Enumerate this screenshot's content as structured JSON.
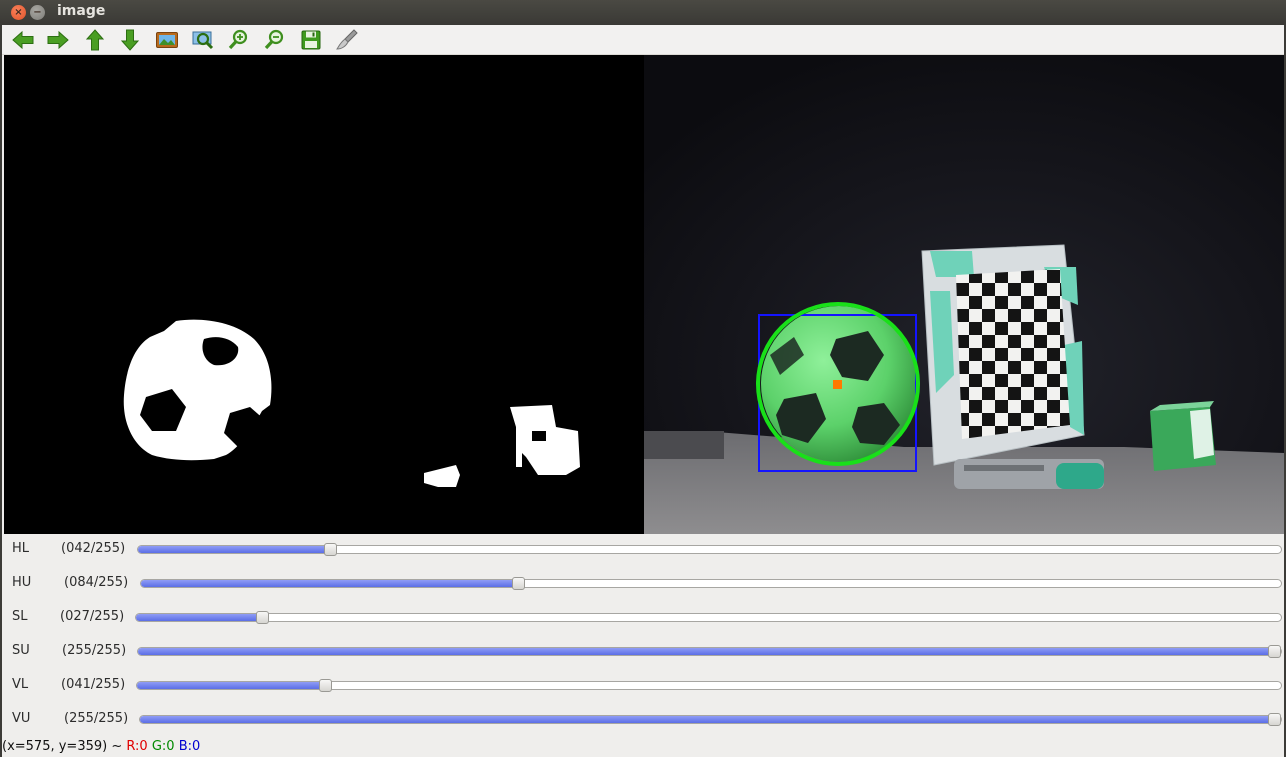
{
  "window": {
    "title": "image"
  },
  "toolbar": {
    "buttons": [
      {
        "name": "pan-left",
        "icon": "arrow-left-icon"
      },
      {
        "name": "pan-right",
        "icon": "arrow-right-icon"
      },
      {
        "name": "pan-up",
        "icon": "arrow-up-icon"
      },
      {
        "name": "pan-down",
        "icon": "arrow-down-icon"
      },
      {
        "name": "zoom-reset",
        "icon": "picture-icon"
      },
      {
        "name": "zoom-fit",
        "icon": "zoom-fit-icon"
      },
      {
        "name": "zoom-in",
        "icon": "zoom-in-icon"
      },
      {
        "name": "zoom-out",
        "icon": "zoom-out-icon"
      },
      {
        "name": "save",
        "icon": "floppy-disk-icon"
      },
      {
        "name": "properties",
        "icon": "brush-icon"
      }
    ],
    "accent": "#3f9a1f"
  },
  "trackbars": [
    {
      "name": "HL",
      "value": "(042/255)",
      "level": 42,
      "max": 255
    },
    {
      "name": "HU",
      "value": "(084/255)",
      "level": 84,
      "max": 255
    },
    {
      "name": "SL",
      "value": "(027/255)",
      "level": 27,
      "max": 255
    },
    {
      "name": "SU",
      "value": "(255/255)",
      "level": 255,
      "max": 255
    },
    {
      "name": "VL",
      "value": "(041/255)",
      "level": 41,
      "max": 255
    },
    {
      "name": "VU",
      "value": "(255/255)",
      "level": 255,
      "max": 255
    }
  ],
  "status": {
    "coords": "(x=575, y=359) ~",
    "r": "R:0",
    "g": "G:0",
    "b": "B:0",
    "colors": {
      "r": "#e00000",
      "g": "#008a00",
      "b": "#0000d0"
    }
  },
  "colors": {
    "detection_circle": "#19e019",
    "bounding_box": "#1414ff",
    "center_marker": "#ff7a00",
    "ball": "#5cd16a"
  }
}
